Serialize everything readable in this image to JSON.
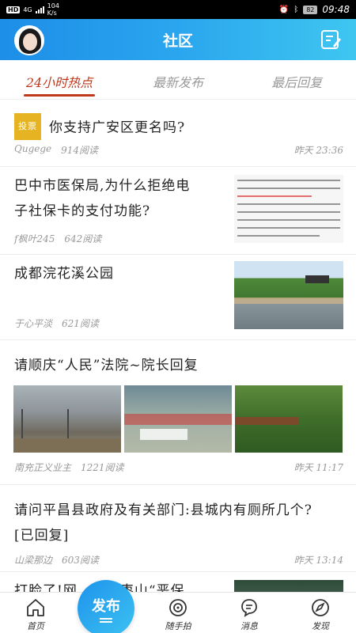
{
  "status_bar": {
    "network_badge": "HD",
    "network_type": "4G",
    "speed_value": "104",
    "speed_unit": "K/s",
    "battery": "82",
    "time": "09:48"
  },
  "header": {
    "title": "社区"
  },
  "tabs": [
    {
      "label": "24小时热点",
      "active": true
    },
    {
      "label": "最新发布",
      "active": false
    },
    {
      "label": "最后回复",
      "active": false
    }
  ],
  "posts": [
    {
      "badge": "投票",
      "title": "你支持广安区更名吗?",
      "author": "Qugege",
      "reads": "914阅读",
      "time": "昨天 23:36"
    },
    {
      "title_line1": "巴中市医保局,为什么拒绝电",
      "title_line2": "子社保卡的支付功能?",
      "author": "f枫叶245",
      "reads": "642阅读",
      "time": ""
    },
    {
      "title": "成都浣花溪公园",
      "author": "于心平淡",
      "reads": "621阅读",
      "time": ""
    },
    {
      "title": "请顺庆“人民”法院~院长回复",
      "author": "南充正义业主",
      "reads": "1221阅读",
      "time": "昨天 11:17"
    },
    {
      "title_line1": "请问平昌县政府及有关部门:县城内有厕所几个?",
      "title_line2": "[已回复]",
      "author": "山梁那边",
      "reads": "603阅读",
      "time": "昨天 13:14"
    },
    {
      "title": "打脸了!网……到枣山“恶保"
    }
  ],
  "bottom_nav": {
    "home": "首页",
    "publish": "发布",
    "snap": "随手拍",
    "messages": "消息",
    "discover": "发现"
  },
  "colors": {
    "accent": "#c0391c",
    "header_start": "#1e8ee8",
    "header_end": "#3fc6f0",
    "badge": "#e6b422"
  }
}
